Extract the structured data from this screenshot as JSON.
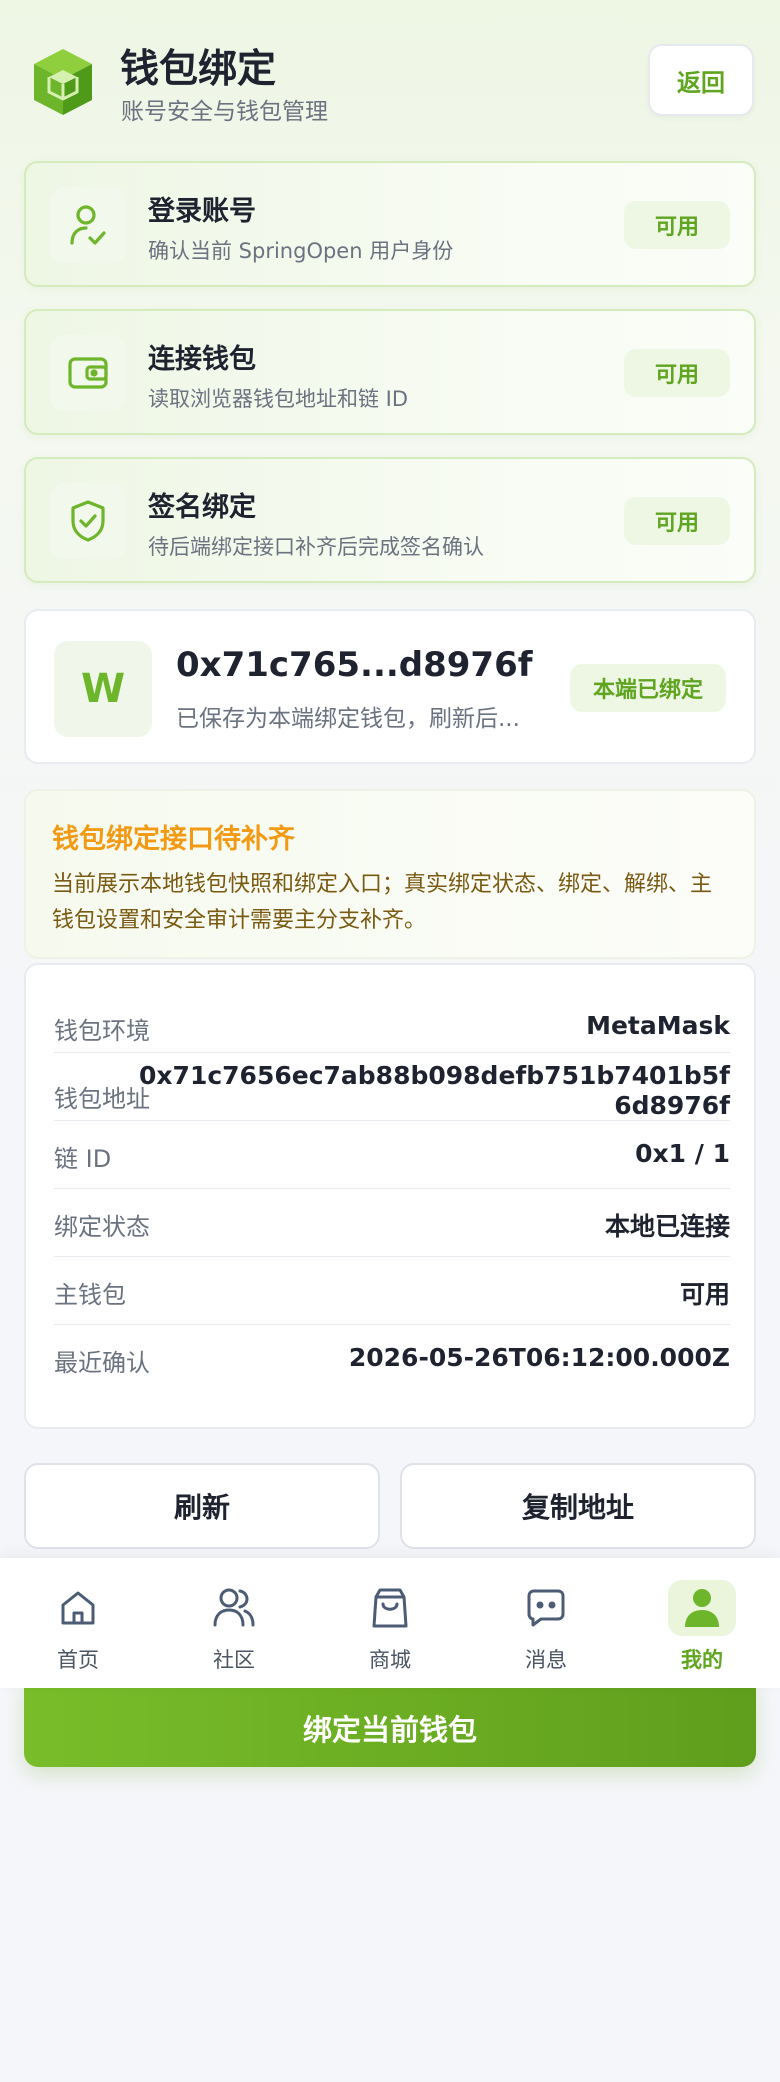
{
  "header": {
    "title": "钱包绑定",
    "subtitle": "账号安全与钱包管理",
    "back_label": "返回"
  },
  "steps": [
    {
      "title": "登录账号",
      "desc": "确认当前 SpringOpen 用户身份",
      "badge": "可用",
      "icon": "user-check-icon"
    },
    {
      "title": "连接钱包",
      "desc": "读取浏览器钱包地址和链 ID",
      "badge": "可用",
      "icon": "wallet-icon"
    },
    {
      "title": "签名绑定",
      "desc": "待后端绑定接口补齐后完成签名确认",
      "badge": "可用",
      "icon": "shield-check-icon"
    }
  ],
  "wallet": {
    "avatar_letter": "W",
    "address_short": "0x71c765...d8976f",
    "note": "已保存为本端绑定钱包，刷新后...",
    "badge": "本端已绑定"
  },
  "notice": {
    "title": "钱包绑定接口待补齐",
    "body": "当前展示本地钱包快照和绑定入口；真实绑定状态、绑定、解绑、主钱包设置和安全审计需要主分支补齐。"
  },
  "details": [
    {
      "label": "钱包环境",
      "value": "MetaMask"
    },
    {
      "label": "钱包地址",
      "value_line1": "0x71c7656ec7ab88b098defb751b7401b5f",
      "value_line2": "6d8976f"
    },
    {
      "label": "链 ID",
      "value": "0x1 / 1"
    },
    {
      "label": "绑定状态",
      "value": "本地已连接"
    },
    {
      "label": "主钱包",
      "value": "可用"
    },
    {
      "label": "最近确认",
      "value": "2026-05-26T06:12:00.000Z"
    }
  ],
  "actions": {
    "refresh_label": "刷新",
    "copy_label": "复制地址",
    "bind_label": "绑定当前钱包"
  },
  "nav": [
    {
      "label": "首页",
      "icon": "home-icon"
    },
    {
      "label": "社区",
      "icon": "users-icon"
    },
    {
      "label": "商城",
      "icon": "shopping-bag-icon"
    },
    {
      "label": "消息",
      "icon": "message-icon"
    },
    {
      "label": "我的",
      "icon": "profile-icon",
      "active": true
    }
  ],
  "colors": {
    "accent": "#6db52a",
    "accent_text": "#5fa51f",
    "warning": "#f39a14"
  }
}
